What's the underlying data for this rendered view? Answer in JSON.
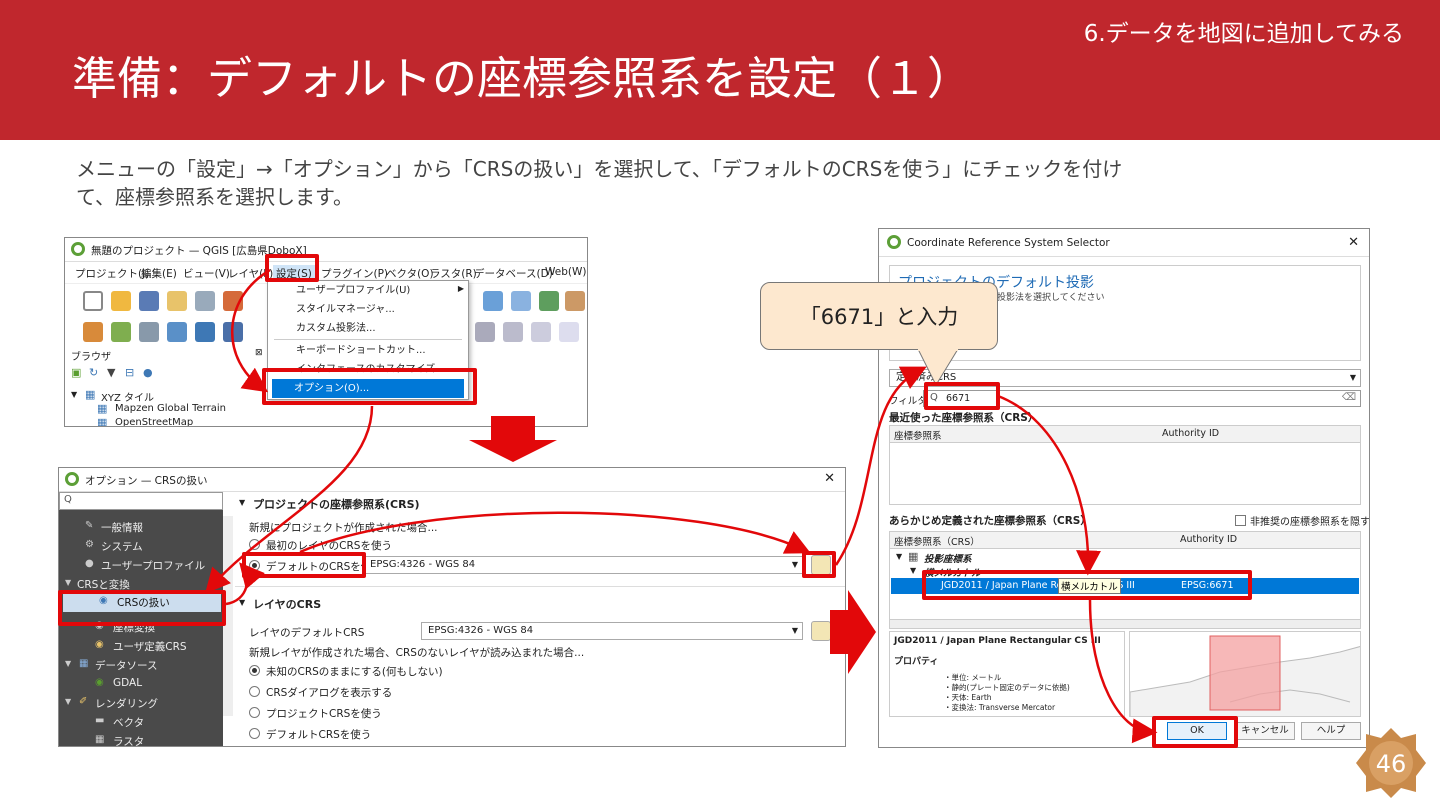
{
  "header": {
    "section": "6.データを地図に追加してみる",
    "title": "準備：デフォルトの座標参照系を設定（１）"
  },
  "description": {
    "line1": "メニューの「設定」→「オプション」から「CRSの扱い」を選択して、「デフォルトのCRSを使う」にチェックを付け",
    "line2": "て、座標参照系を選択します。"
  },
  "qgis": {
    "title": "無題のプロジェクト — QGIS [広島県DoboX]",
    "menus": [
      "プロジェクト(J)",
      "編集(E)",
      "ビュー(V)",
      "レイヤ(L)",
      "設定(S)",
      "プラグイン(P)",
      "ベクタ(O)",
      "ラスタ(R)",
      "データベース(D)",
      "Web(W)"
    ],
    "browser_label": "ブラウザ",
    "tree_root": "XYZ タイル",
    "tree_items": [
      "Mapzen Global Terrain",
      "OpenStreetMap"
    ],
    "settings_menu": [
      "ユーザープロファイル(U)",
      "スタイルマネージャ...",
      "カスタム投影法...",
      "キーボードショートカット...",
      "インタフェースのカスタマイズ...",
      "オプション(O)..."
    ]
  },
  "options": {
    "title": "オプション — CRSの扱い",
    "search_placeholder": "Q",
    "sidebar": [
      "一般情報",
      "システム",
      "ユーザープロファイル",
      "CRSと変換",
      "CRSの扱い",
      "座標変換",
      "ユーザ定義CRS",
      "データソース",
      "GDAL",
      "レンダリング",
      "ベクタ",
      "ラスタ"
    ],
    "section1": "プロジェクトの座標参照系(CRS)",
    "new_project_note": "新規にプロジェクトが作成された場合...",
    "radio1": "最初のレイヤのCRSを使う",
    "radio2": "デフォルトのCRSを使う",
    "default_crs": "EPSG:4326 - WGS 84",
    "section2": "レイヤのCRS",
    "layer_default_label": "レイヤのデフォルトCRS",
    "layer_default_crs": "EPSG:4326 - WGS 84",
    "new_layer_note": "新規レイヤが作成された場合、CRSのないレイヤが読み込まれた場合...",
    "layer_radios": [
      "未知のCRSのままにする(何もしない)",
      "CRSダイアログを表示する",
      "プロジェクトCRSを使う",
      "デフォルトCRSを使う"
    ]
  },
  "crs": {
    "title": "Coordinate Reference System Selector",
    "heading": "プロジェクトのデフォルト投影",
    "subheading": "新規プロジェクトに使う投影法を選択してください",
    "defined_label": "定義済みCRS",
    "filter_label": "フィルタ",
    "filter_value": "6671",
    "recent_label": "最近使った座標参照系（CRS）",
    "col_crs": "座標参照系",
    "col_auth": "Authority ID",
    "predef_label": "あらかじめ定義された座標参照系（CRS）",
    "hide_deprecated": "非推奨の座標参照系を隠す",
    "col_crs2": "座標参照系（CRS）",
    "col_auth2": "Authority ID",
    "tree_projected": "投影座標系",
    "tree_mercator": "横メルカトル",
    "selected_name": "JGD2011 / Japan Plane Rectangular CS III",
    "selected_auth": "EPSG:6671",
    "tooltip": "横メルカトル",
    "detail_name": "JGD2011 / Japan Plane Rectangular CS III",
    "properties_label": "プロパティ",
    "properties": [
      "・単位: メートル",
      "・静的(プレート固定のデータに依拠)",
      "・天体: Earth",
      "・変換法: Transverse Mercator"
    ],
    "ok": "OK",
    "cancel": "キャンセル",
    "help": "ヘルプ"
  },
  "callout": {
    "text": "「6671」と入力"
  },
  "page": {
    "number": "46"
  },
  "colors": {
    "header": "#c0272d",
    "highlight": "#e2080a",
    "selection": "#0078d7",
    "callout": "#fde8cf",
    "badge": "#c98a4a"
  }
}
